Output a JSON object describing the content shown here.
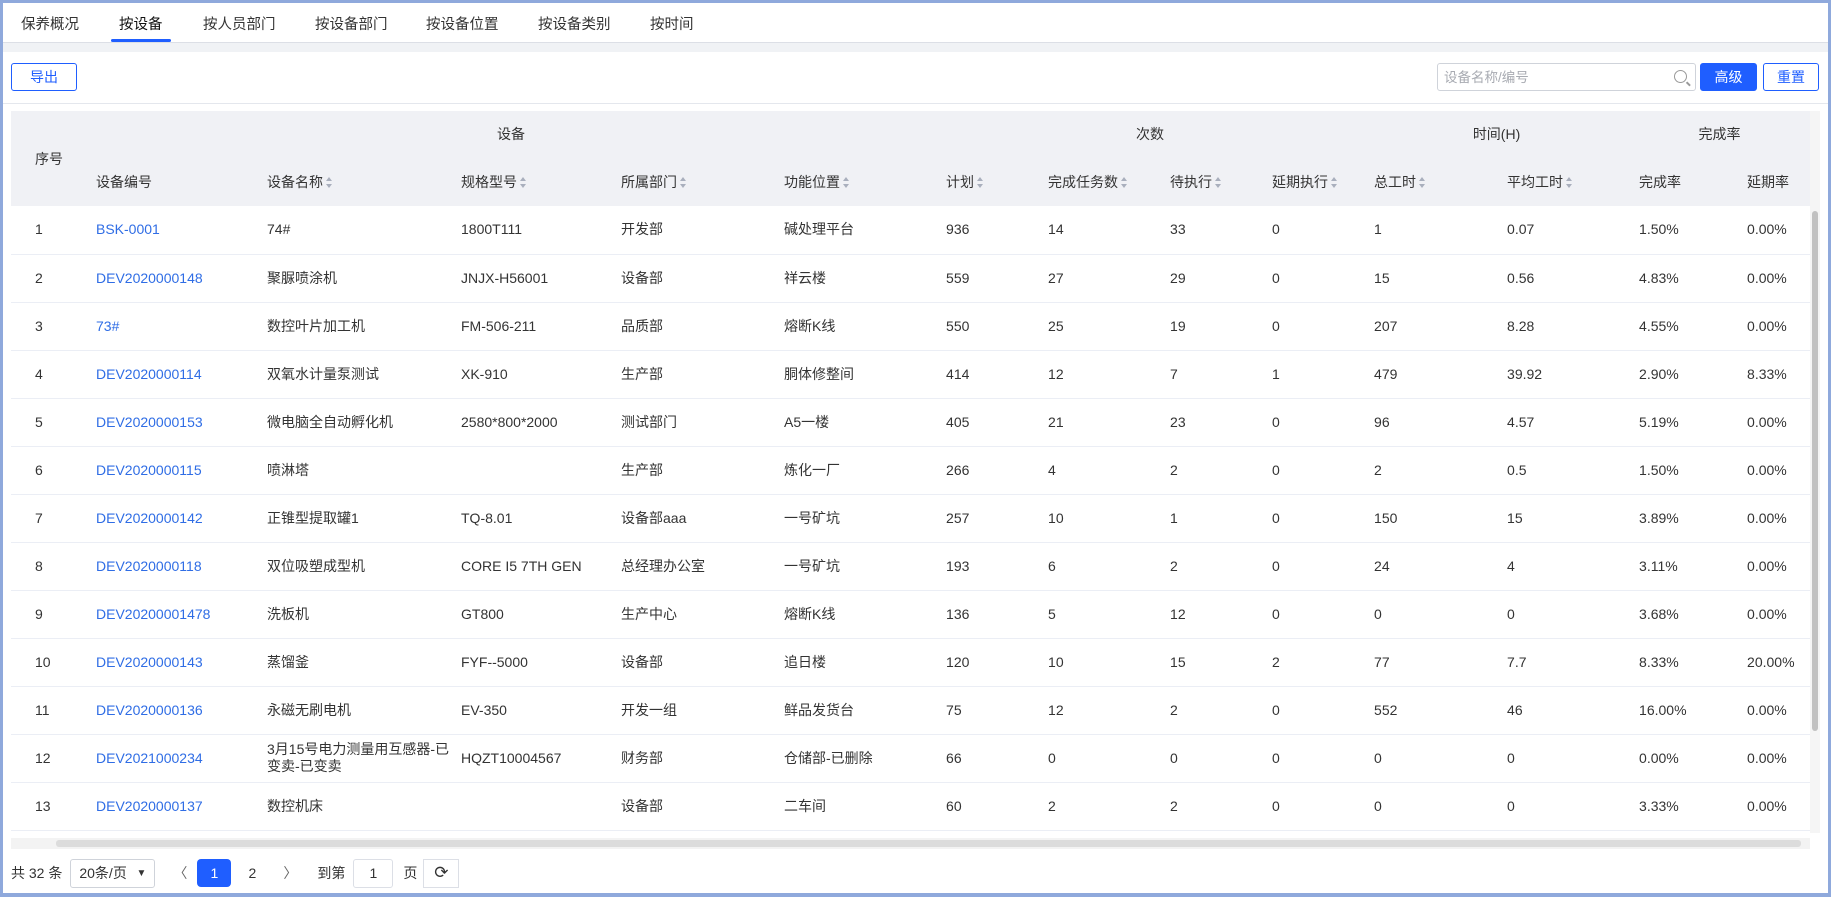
{
  "tabs": [
    "保养概况",
    "按设备",
    "按人员部门",
    "按设备部门",
    "按设备位置",
    "按设备类别",
    "按时间"
  ],
  "active_tab": 1,
  "toolbar": {
    "export": "导出",
    "search_placeholder": "设备名称/编号",
    "advanced": "高级",
    "reset": "重置"
  },
  "table": {
    "index_header": "序号",
    "groups": [
      "设备",
      "次数",
      "时间(H)",
      "完成率"
    ],
    "columns": [
      "设备编号",
      "设备名称",
      "规格型号",
      "所属部门",
      "功能位置",
      "计划",
      "完成任务数",
      "待执行",
      "延期执行",
      "总工时",
      "平均工时",
      "完成率",
      "延期率"
    ],
    "rows": [
      [
        "1",
        "BSK-0001",
        "74#",
        "1800T111",
        "开发部",
        "碱处理平台",
        "936",
        "14",
        "33",
        "0",
        "1",
        "0.07",
        "1.50%",
        "0.00%"
      ],
      [
        "2",
        "DEV2020000148",
        "聚脲喷涂机",
        "JNJX-H56001",
        "设备部",
        "祥云楼",
        "559",
        "27",
        "29",
        "0",
        "15",
        "0.56",
        "4.83%",
        "0.00%"
      ],
      [
        "3",
        "73#",
        "数控叶片加工机",
        "FM-506-211",
        "品质部",
        "熔断K线",
        "550",
        "25",
        "19",
        "0",
        "207",
        "8.28",
        "4.55%",
        "0.00%"
      ],
      [
        "4",
        "DEV2020000114",
        "双氧水计量泵测试",
        "XK-910",
        "生产部",
        "胴体修整间",
        "414",
        "12",
        "7",
        "1",
        "479",
        "39.92",
        "2.90%",
        "8.33%"
      ],
      [
        "5",
        "DEV2020000153",
        "微电脑全自动孵化机",
        "2580*800*2000",
        "测试部门",
        "A5一楼",
        "405",
        "21",
        "23",
        "0",
        "96",
        "4.57",
        "5.19%",
        "0.00%"
      ],
      [
        "6",
        "DEV2020000115",
        "喷淋塔",
        "",
        "生产部",
        "炼化一厂",
        "266",
        "4",
        "2",
        "0",
        "2",
        "0.5",
        "1.50%",
        "0.00%"
      ],
      [
        "7",
        "DEV2020000142",
        "正锥型提取罐1",
        "TQ-8.01",
        "设备部aaa",
        "一号矿坑",
        "257",
        "10",
        "1",
        "0",
        "150",
        "15",
        "3.89%",
        "0.00%"
      ],
      [
        "8",
        "DEV2020000118",
        "双位吸塑成型机",
        "CORE I5 7TH GEN",
        "总经理办公室",
        "一号矿坑",
        "193",
        "6",
        "2",
        "0",
        "24",
        "4",
        "3.11%",
        "0.00%"
      ],
      [
        "9",
        "DEV20200001478",
        "洗板机",
        "GT800",
        "生产中心",
        "熔断K线",
        "136",
        "5",
        "12",
        "0",
        "0",
        "0",
        "3.68%",
        "0.00%"
      ],
      [
        "10",
        "DEV2020000143",
        "蒸馏釜",
        "FYF--5000",
        "设备部",
        "追日楼",
        "120",
        "10",
        "15",
        "2",
        "77",
        "7.7",
        "8.33%",
        "20.00%"
      ],
      [
        "11",
        "DEV2020000136",
        "永磁无刷电机",
        "EV-350",
        "开发一组",
        "鲜品发货台",
        "75",
        "12",
        "2",
        "0",
        "552",
        "46",
        "16.00%",
        "0.00%"
      ],
      [
        "12",
        "DEV2021000234",
        "3月15号电力测量用互感器-已变卖-已变卖",
        "HQZT10004567",
        "财务部",
        "仓储部-已删除",
        "66",
        "0",
        "0",
        "0",
        "0",
        "0",
        "0.00%",
        "0.00%"
      ],
      [
        "13",
        "DEV2020000137",
        "数控机床",
        "",
        "设备部",
        "二车间",
        "60",
        "2",
        "2",
        "0",
        "0",
        "0",
        "3.33%",
        "0.00%"
      ]
    ]
  },
  "pagination": {
    "total": "共 32 条",
    "page_size": "20条/页",
    "prev": "〈",
    "pages": [
      "1",
      "2"
    ],
    "next": "〉",
    "goto": "到第",
    "goto_value": "1",
    "page_suffix": "页"
  }
}
